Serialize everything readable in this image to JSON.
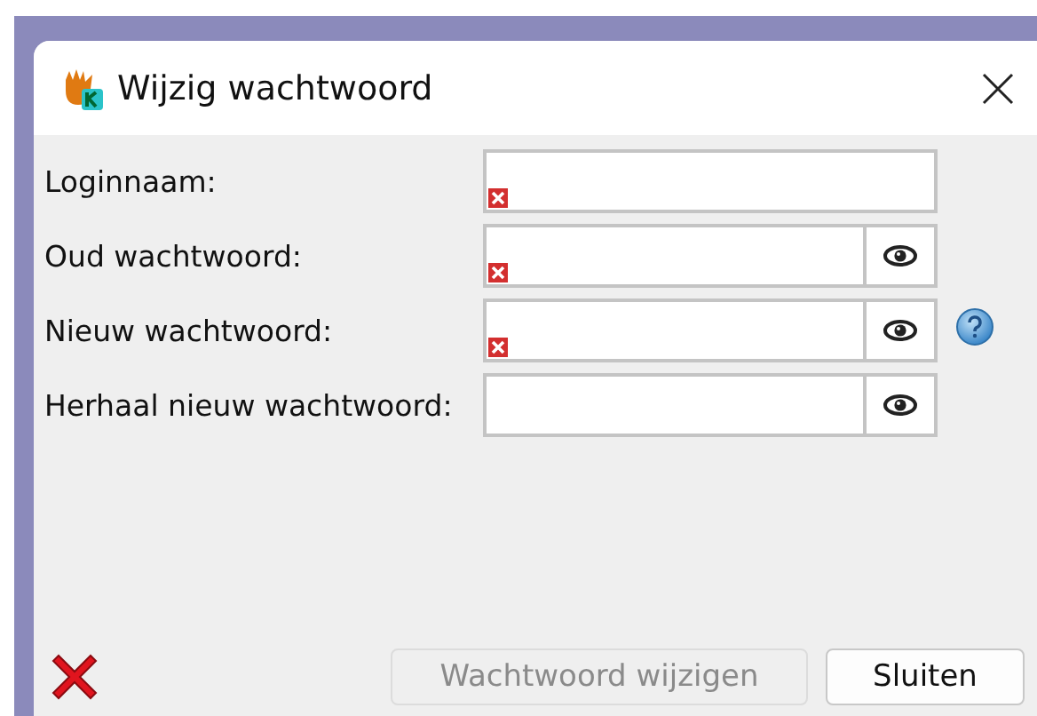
{
  "window": {
    "title": "Wijzig wachtwoord"
  },
  "fields": [
    {
      "label": "Loginnaam:",
      "kind": "text",
      "invalid": true,
      "help": false
    },
    {
      "label": "Oud wachtwoord:",
      "kind": "password",
      "invalid": true,
      "help": false
    },
    {
      "label": "Nieuw wachtwoord:",
      "kind": "password",
      "invalid": true,
      "help": true
    },
    {
      "label": "Herhaal nieuw wachtwoord:",
      "kind": "password",
      "invalid": false,
      "help": false
    }
  ],
  "buttons": [
    {
      "label": "Wachtwoord wijzigen",
      "disabled": true
    },
    {
      "label": "Sluiten",
      "disabled": false
    }
  ]
}
